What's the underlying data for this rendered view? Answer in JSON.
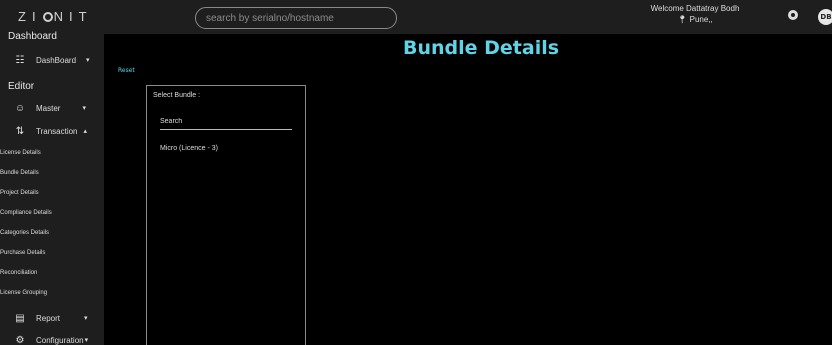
{
  "header": {
    "logo_left": "ZI",
    "logo_right": "NIT",
    "search_placeholder": "search by serialno/hostname",
    "welcome": "Welcome Dattatray Bodh",
    "location": "Pune,,",
    "avatar_initials": "DB"
  },
  "sidebar": {
    "dashboard_section": "Dashboard",
    "dashboard_item": "DashBoard",
    "editor_section": "Editor",
    "master_item": "Master",
    "transaction_item": "Transaction",
    "sub_items": [
      "License Details",
      "Bundle Details",
      "Project Details",
      "Compliance Details",
      "Categories Details",
      "Purchase Details",
      "Reconciliation",
      "License Grouping"
    ],
    "report_item": "Report",
    "configuration_item": "Configuration"
  },
  "main": {
    "title": "Bundle Details",
    "reset_label": "Reset",
    "select_label": "Select Bundle :",
    "search_placeholder": "Search",
    "bundles": [
      "Micro (Licence - 3)"
    ]
  },
  "colors": {
    "accent": "#5fd4e6",
    "sidebar_bg": "#1e1e1e",
    "page_bg": "#000000"
  }
}
